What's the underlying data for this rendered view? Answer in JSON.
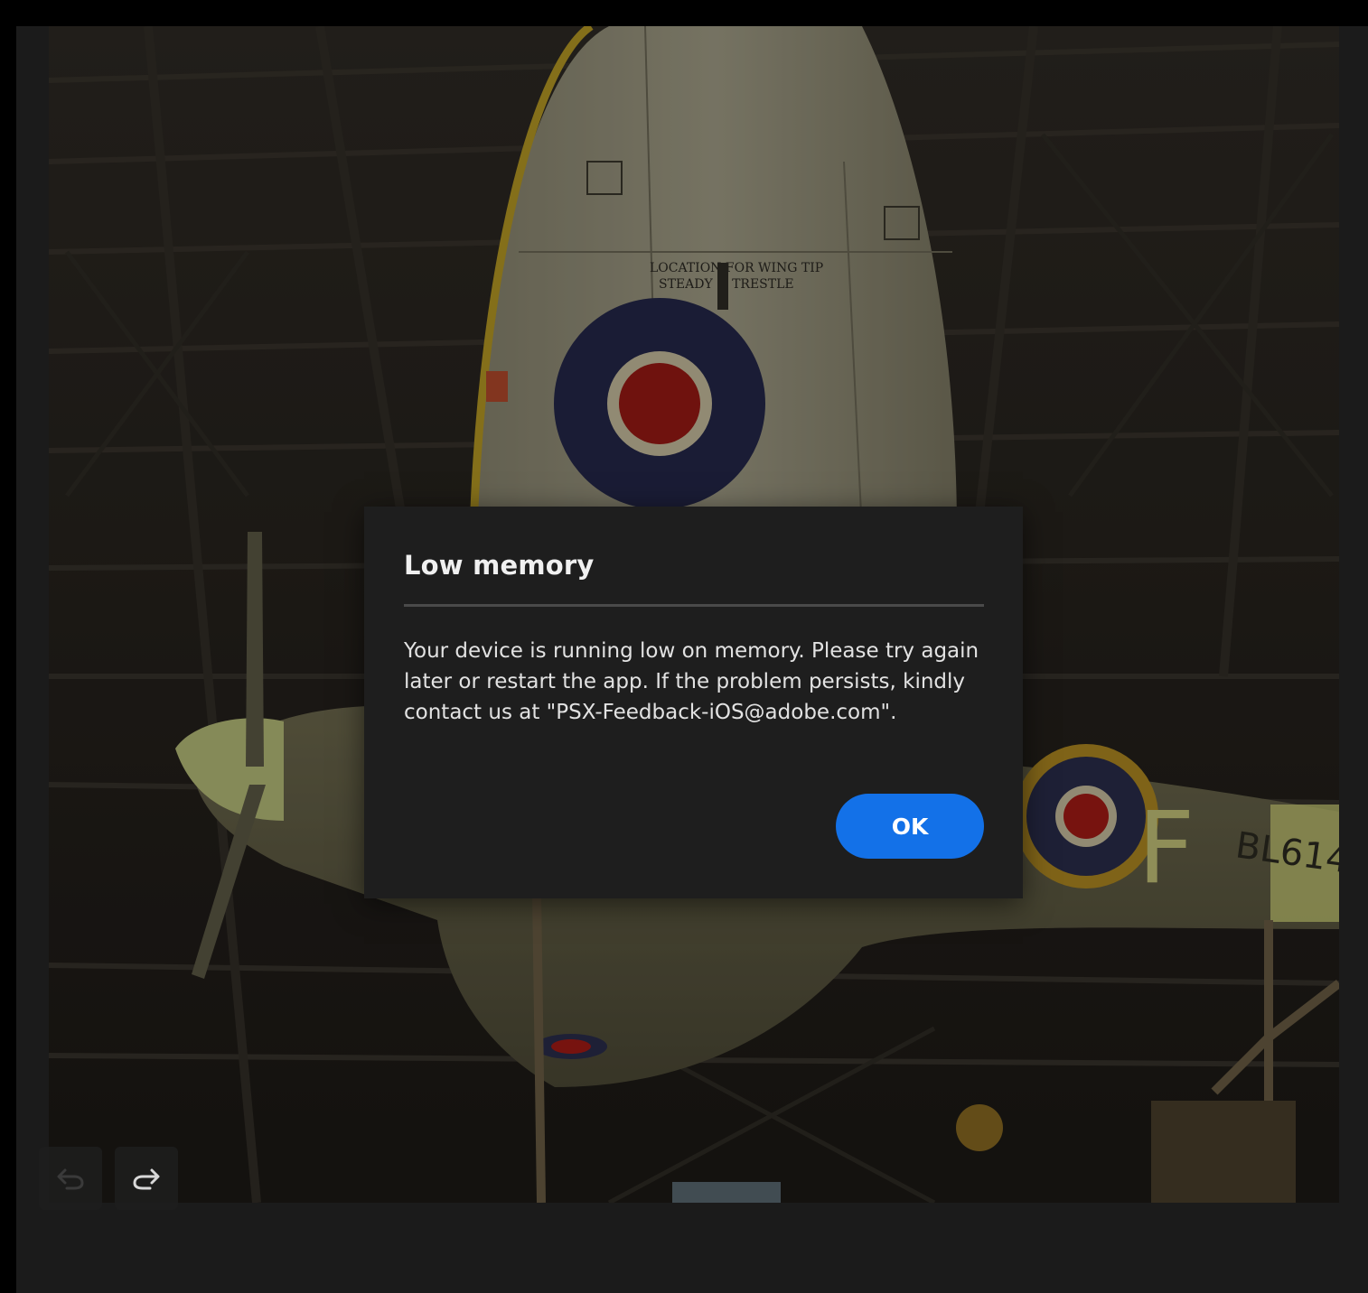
{
  "dialog": {
    "title": "Low memory",
    "message": "Your device is running low on memory. Please try again later or restart the app. If the problem persists, kindly contact us at \"PSX-Feedback-iOS@adobe.com\".",
    "ok_label": "OK"
  },
  "toolbar": {
    "undo_icon": "undo-icon",
    "redo_icon": "redo-icon"
  },
  "photo": {
    "wing_stencil_line1": "LOCATION FOR WING TIP",
    "wing_stencil_line2": "STEADY & TRESTLE",
    "fuselage_letter": "F",
    "serial": "BL614"
  },
  "colors": {
    "accent": "#1371e8",
    "dialog_bg": "#1e1e1e",
    "app_bg": "#1b1b1b"
  }
}
